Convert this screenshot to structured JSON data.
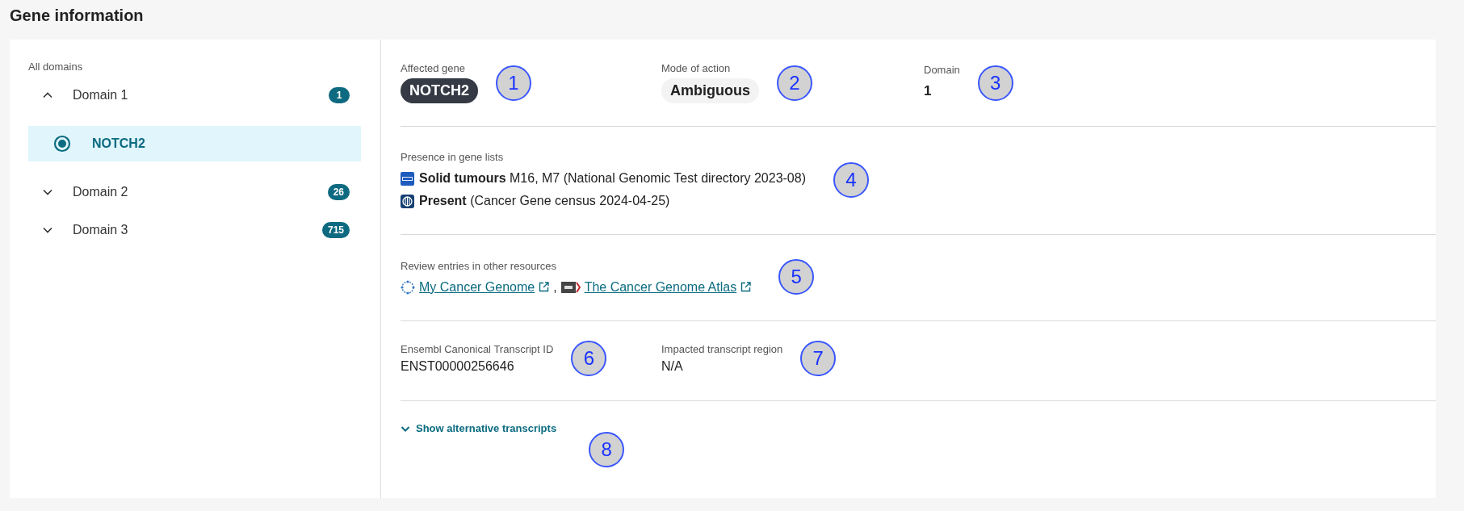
{
  "title": "Gene information",
  "sidebar": {
    "heading": "All domains",
    "domains": [
      {
        "label": "Domain 1",
        "count": "1",
        "expanded": true,
        "children": [
          {
            "label": "NOTCH2",
            "selected": true
          }
        ]
      },
      {
        "label": "Domain 2",
        "count": "26",
        "expanded": false
      },
      {
        "label": "Domain 3",
        "count": "715",
        "expanded": false
      }
    ]
  },
  "summary": [
    {
      "label": "Affected gene",
      "value": "NOTCH2",
      "kind": "dark-pill",
      "callout": "1"
    },
    {
      "label": "Mode of action",
      "value": "Ambiguous",
      "kind": "light-pill",
      "callout": "2"
    },
    {
      "label": "Domain",
      "value": "1",
      "kind": "plain",
      "callout": "3"
    }
  ],
  "gene_lists": {
    "label": "Presence in gene lists",
    "callout": "4",
    "entries": [
      {
        "kind": "nhs",
        "text": "**Solid tumours** M16, M7 (National Genomic Test directory 2023-08)"
      },
      {
        "kind": "census",
        "text": "**Present** (Cancer Gene census 2024-04-25)"
      }
    ]
  },
  "resources": {
    "label": "Review entries in other resources",
    "callout": "5",
    "separator": ",",
    "links": [
      {
        "kind": "network",
        "text": "My Cancer Genome"
      },
      {
        "kind": "nih",
        "text": "The Cancer Genome Atlas"
      }
    ]
  },
  "transcript": [
    {
      "label": "Ensembl Canonical Transcript ID",
      "value": "ENST00000256646",
      "callout": "6"
    },
    {
      "label": "Impacted transcript region",
      "value": "N/A",
      "callout": "7"
    }
  ],
  "alternatives": {
    "label": "Show alternative transcripts",
    "expanded": false,
    "callout": "8"
  }
}
